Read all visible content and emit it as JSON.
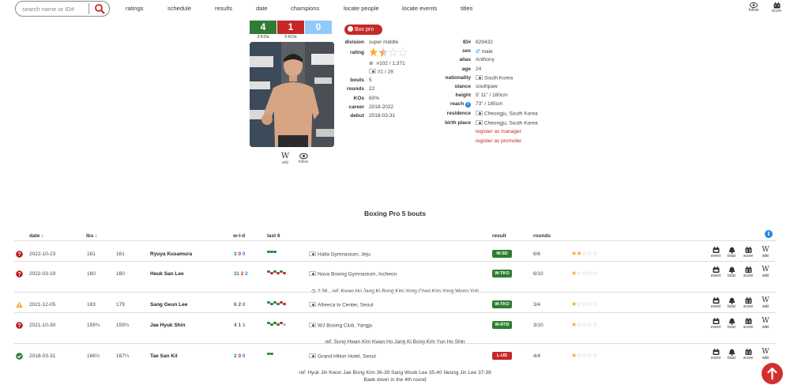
{
  "search": {
    "placeholder": "search name or ID#"
  },
  "nav": {
    "links": [
      "ratings",
      "schedule",
      "results",
      "date",
      "champions",
      "locate people",
      "locate events",
      "titles"
    ],
    "follow": "follow",
    "score": "score"
  },
  "record": {
    "wins": "4",
    "losses": "1",
    "draws": "0",
    "wins_kos": "3 KOs",
    "losses_kos": "0 KOs",
    "colors": {
      "win": "#2e7d32",
      "loss": "#c62828",
      "draw": "#90caf9"
    }
  },
  "profile": {
    "badge": "Box pro",
    "wiki": "wiki",
    "follow": "follow",
    "left": {
      "division_label": "division",
      "division": "super middle",
      "rating_label": "rating",
      "rating_stars": 1.5,
      "world_rank": "#102 / 1,371",
      "country_rank": "#1 / 28",
      "bouts_label": "bouts",
      "bouts": "5",
      "rounds_label": "rounds",
      "rounds": "22",
      "kos_label": "KOs",
      "kos": "60%",
      "career_label": "career",
      "career": "2018-2022",
      "debut_label": "debut",
      "debut": "2018-03-31"
    },
    "right": {
      "id_label": "ID#",
      "id": "829432",
      "sex_label": "sex",
      "sex": "male",
      "alias_label": "alias",
      "alias": "Anthony",
      "age_label": "age",
      "age": "24",
      "nationality_label": "nationality",
      "nationality": "South Korea",
      "stance_label": "stance",
      "stance": "southpaw",
      "height_label": "height",
      "height": "5′ 11″   /   180cm",
      "reach_label": "reach",
      "reach": "73″   /   185cm",
      "residence_label": "residence",
      "residence": "Cheongju, South Korea",
      "birthplace_label": "birth place",
      "birthplace": "Cheongju, South Korea",
      "register_manager": "register as manager",
      "register_promoter": "register as promoter"
    }
  },
  "table": {
    "title": "Boxing Pro 5 bouts",
    "headers": {
      "date": "date",
      "lbs": "lbs",
      "wld": "w-l-d",
      "last6": "last 6",
      "result": "result",
      "rounds": "rounds"
    },
    "rows": [
      {
        "status": "loss",
        "date": "2022-10-23",
        "lbs1": "161",
        "lbs2": "161",
        "opponent": "Ryuya Kusamura",
        "w": "3",
        "l": "0",
        "d": "0",
        "last6": [
          "g",
          "g",
          "g"
        ],
        "venue": "Halla Gymnasium, Jeju",
        "result": "W-SD",
        "result_color": "#2e7d32",
        "rounds": "6/6",
        "stars": 2
      },
      {
        "status": "loss",
        "date": "2022-03-19",
        "lbs1": "160",
        "lbs2": "160",
        "opponent": "Heuk San Lee",
        "w": "11",
        "l": "2",
        "d": "2",
        "last6": [
          "g",
          "r",
          "g",
          "r",
          "g",
          "r"
        ],
        "venue": "Nova Boxing Gymnasium, Incheon",
        "result": "W-TKO",
        "result_color": "#2e7d32",
        "rounds": "6/10",
        "stars": 1,
        "time": "2:38",
        "ref": "ref: Kwan Ho Jang   Ki Bong Kim   Yong Chan Kim   Yong Woon Yuh"
      },
      {
        "status": "warn",
        "date": "2021-12-05",
        "lbs1": "183",
        "lbs2": "179",
        "opponent": "Sang Geun Lee",
        "w": "6",
        "l": "2",
        "d": "0",
        "last6": [
          "g",
          "g",
          "g",
          "g",
          "r",
          "r"
        ],
        "venue": "Afreeca tv Center, Seoul",
        "result": "W-TKO",
        "result_color": "#2e7d32",
        "rounds": "3/4",
        "stars": 1
      },
      {
        "status": "loss",
        "date": "2021-10-30",
        "lbs1": "159¾",
        "lbs2": "159¾",
        "opponent": "Jae Hyuk Shin",
        "w": "4",
        "l": "1",
        "d": "1",
        "last6": [
          "g",
          "g",
          "g",
          "g",
          "r",
          "b"
        ],
        "venue": "WJ Boxing Club, Yangju",
        "result": "W-RTD",
        "result_color": "#2e7d32",
        "rounds": "3/10",
        "stars": 1,
        "ref": "ref: Sung Hwan Kim   Kwan Ho Jang   Ki Bong Kim   Yun Ho Shin"
      },
      {
        "status": "ok",
        "date": "2018-03-31",
        "lbs1": "166½",
        "lbs2": "167¼",
        "opponent": "Tae San Kil",
        "w": "2",
        "l": "0",
        "d": "0",
        "last6": [
          "g",
          "g"
        ],
        "venue": "Grand Hilton Hotel, Seoul",
        "result": "L-UD",
        "result_color": "#c62828",
        "rounds": "4/4",
        "stars": 1,
        "ref": "ref: Hyuk Jin Kwon   Jae Bong Kim 36-39   Sang Wook Lee 35-40   Neung Jin Lee 37-39",
        "note": "Baek down in the 4th round"
      }
    ],
    "actions": [
      "event",
      "bout",
      "score",
      "wiki"
    ]
  }
}
